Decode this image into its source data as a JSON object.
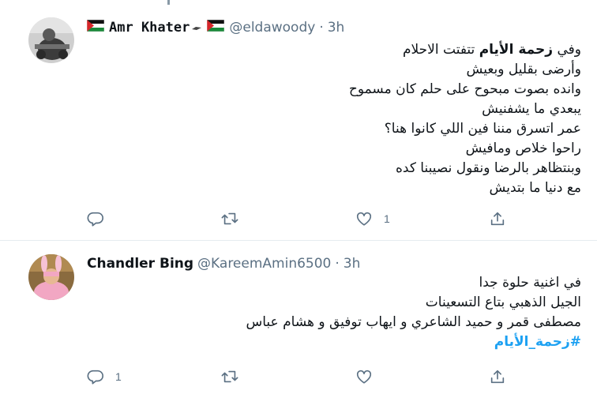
{
  "tweets": [
    {
      "display_name": "Amr Khater",
      "handle": "@eldawoody",
      "separator": "·",
      "time": "3h",
      "lines": [
        {
          "pre": "وفي ",
          "bold": "زحمة الأيام",
          "post": " تتفتت الاحلام"
        },
        {
          "text": "وأرضى بقليل وبعيش"
        },
        {
          "text": "وانده بصوت مبحوح على حلم كان مسموح"
        },
        {
          "text": "يبعدي ما يشفنيش"
        },
        {
          "text": "عمر اتسرق مننا فين اللي كانوا هنا؟"
        },
        {
          "text": "راحوا خلاص ومافيش"
        },
        {
          "text": "وبنتظاهر بالرضا ونقول نصيبنا كده"
        },
        {
          "text": "مع دنيا ما بتديش"
        }
      ],
      "reply_count": "",
      "retweet_count": "",
      "like_count": "1"
    },
    {
      "display_name": "Chandler Bing",
      "handle": "@KareemAmin6500",
      "separator": "·",
      "time": "3h",
      "lines": [
        {
          "text": "في اغنية حلوة جدا"
        },
        {
          "text": "الجيل الذهبي بتاع التسعينات"
        },
        {
          "text": "مصطفى قمر و حميد الشاعري و ايهاب توفيق و هشام عباس"
        },
        {
          "hashtag": "#زحمة_الأيام"
        }
      ],
      "reply_count": "1",
      "retweet_count": "",
      "like_count": ""
    }
  ],
  "icons": {
    "reply": "reply-icon",
    "retweet": "retweet-icon",
    "like": "like-icon",
    "share": "share-icon",
    "flag": "palestine-flag-icon"
  },
  "colors": {
    "secondary_text": "#5b7083",
    "hashtag": "#1da1f2",
    "divider": "#e6ecf0",
    "icon": "#5b7083"
  }
}
